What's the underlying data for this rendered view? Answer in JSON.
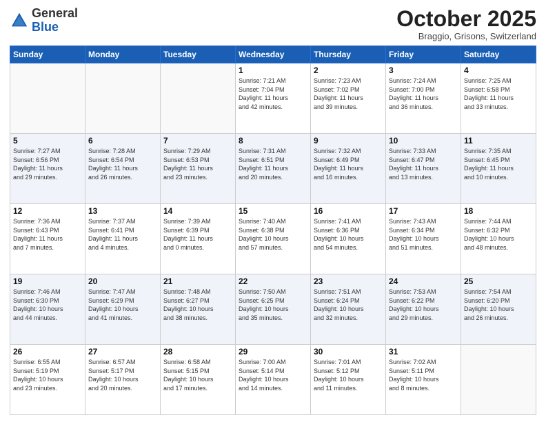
{
  "header": {
    "logo_general": "General",
    "logo_blue": "Blue",
    "month": "October 2025",
    "location": "Braggio, Grisons, Switzerland"
  },
  "weekdays": [
    "Sunday",
    "Monday",
    "Tuesday",
    "Wednesday",
    "Thursday",
    "Friday",
    "Saturday"
  ],
  "weeks": [
    [
      {
        "day": "",
        "info": ""
      },
      {
        "day": "",
        "info": ""
      },
      {
        "day": "",
        "info": ""
      },
      {
        "day": "1",
        "info": "Sunrise: 7:21 AM\nSunset: 7:04 PM\nDaylight: 11 hours\nand 42 minutes."
      },
      {
        "day": "2",
        "info": "Sunrise: 7:23 AM\nSunset: 7:02 PM\nDaylight: 11 hours\nand 39 minutes."
      },
      {
        "day": "3",
        "info": "Sunrise: 7:24 AM\nSunset: 7:00 PM\nDaylight: 11 hours\nand 36 minutes."
      },
      {
        "day": "4",
        "info": "Sunrise: 7:25 AM\nSunset: 6:58 PM\nDaylight: 11 hours\nand 33 minutes."
      }
    ],
    [
      {
        "day": "5",
        "info": "Sunrise: 7:27 AM\nSunset: 6:56 PM\nDaylight: 11 hours\nand 29 minutes."
      },
      {
        "day": "6",
        "info": "Sunrise: 7:28 AM\nSunset: 6:54 PM\nDaylight: 11 hours\nand 26 minutes."
      },
      {
        "day": "7",
        "info": "Sunrise: 7:29 AM\nSunset: 6:53 PM\nDaylight: 11 hours\nand 23 minutes."
      },
      {
        "day": "8",
        "info": "Sunrise: 7:31 AM\nSunset: 6:51 PM\nDaylight: 11 hours\nand 20 minutes."
      },
      {
        "day": "9",
        "info": "Sunrise: 7:32 AM\nSunset: 6:49 PM\nDaylight: 11 hours\nand 16 minutes."
      },
      {
        "day": "10",
        "info": "Sunrise: 7:33 AM\nSunset: 6:47 PM\nDaylight: 11 hours\nand 13 minutes."
      },
      {
        "day": "11",
        "info": "Sunrise: 7:35 AM\nSunset: 6:45 PM\nDaylight: 11 hours\nand 10 minutes."
      }
    ],
    [
      {
        "day": "12",
        "info": "Sunrise: 7:36 AM\nSunset: 6:43 PM\nDaylight: 11 hours\nand 7 minutes."
      },
      {
        "day": "13",
        "info": "Sunrise: 7:37 AM\nSunset: 6:41 PM\nDaylight: 11 hours\nand 4 minutes."
      },
      {
        "day": "14",
        "info": "Sunrise: 7:39 AM\nSunset: 6:39 PM\nDaylight: 11 hours\nand 0 minutes."
      },
      {
        "day": "15",
        "info": "Sunrise: 7:40 AM\nSunset: 6:38 PM\nDaylight: 10 hours\nand 57 minutes."
      },
      {
        "day": "16",
        "info": "Sunrise: 7:41 AM\nSunset: 6:36 PM\nDaylight: 10 hours\nand 54 minutes."
      },
      {
        "day": "17",
        "info": "Sunrise: 7:43 AM\nSunset: 6:34 PM\nDaylight: 10 hours\nand 51 minutes."
      },
      {
        "day": "18",
        "info": "Sunrise: 7:44 AM\nSunset: 6:32 PM\nDaylight: 10 hours\nand 48 minutes."
      }
    ],
    [
      {
        "day": "19",
        "info": "Sunrise: 7:46 AM\nSunset: 6:30 PM\nDaylight: 10 hours\nand 44 minutes."
      },
      {
        "day": "20",
        "info": "Sunrise: 7:47 AM\nSunset: 6:29 PM\nDaylight: 10 hours\nand 41 minutes."
      },
      {
        "day": "21",
        "info": "Sunrise: 7:48 AM\nSunset: 6:27 PM\nDaylight: 10 hours\nand 38 minutes."
      },
      {
        "day": "22",
        "info": "Sunrise: 7:50 AM\nSunset: 6:25 PM\nDaylight: 10 hours\nand 35 minutes."
      },
      {
        "day": "23",
        "info": "Sunrise: 7:51 AM\nSunset: 6:24 PM\nDaylight: 10 hours\nand 32 minutes."
      },
      {
        "day": "24",
        "info": "Sunrise: 7:53 AM\nSunset: 6:22 PM\nDaylight: 10 hours\nand 29 minutes."
      },
      {
        "day": "25",
        "info": "Sunrise: 7:54 AM\nSunset: 6:20 PM\nDaylight: 10 hours\nand 26 minutes."
      }
    ],
    [
      {
        "day": "26",
        "info": "Sunrise: 6:55 AM\nSunset: 5:19 PM\nDaylight: 10 hours\nand 23 minutes."
      },
      {
        "day": "27",
        "info": "Sunrise: 6:57 AM\nSunset: 5:17 PM\nDaylight: 10 hours\nand 20 minutes."
      },
      {
        "day": "28",
        "info": "Sunrise: 6:58 AM\nSunset: 5:15 PM\nDaylight: 10 hours\nand 17 minutes."
      },
      {
        "day": "29",
        "info": "Sunrise: 7:00 AM\nSunset: 5:14 PM\nDaylight: 10 hours\nand 14 minutes."
      },
      {
        "day": "30",
        "info": "Sunrise: 7:01 AM\nSunset: 5:12 PM\nDaylight: 10 hours\nand 11 minutes."
      },
      {
        "day": "31",
        "info": "Sunrise: 7:02 AM\nSunset: 5:11 PM\nDaylight: 10 hours\nand 8 minutes."
      },
      {
        "day": "",
        "info": ""
      }
    ]
  ]
}
